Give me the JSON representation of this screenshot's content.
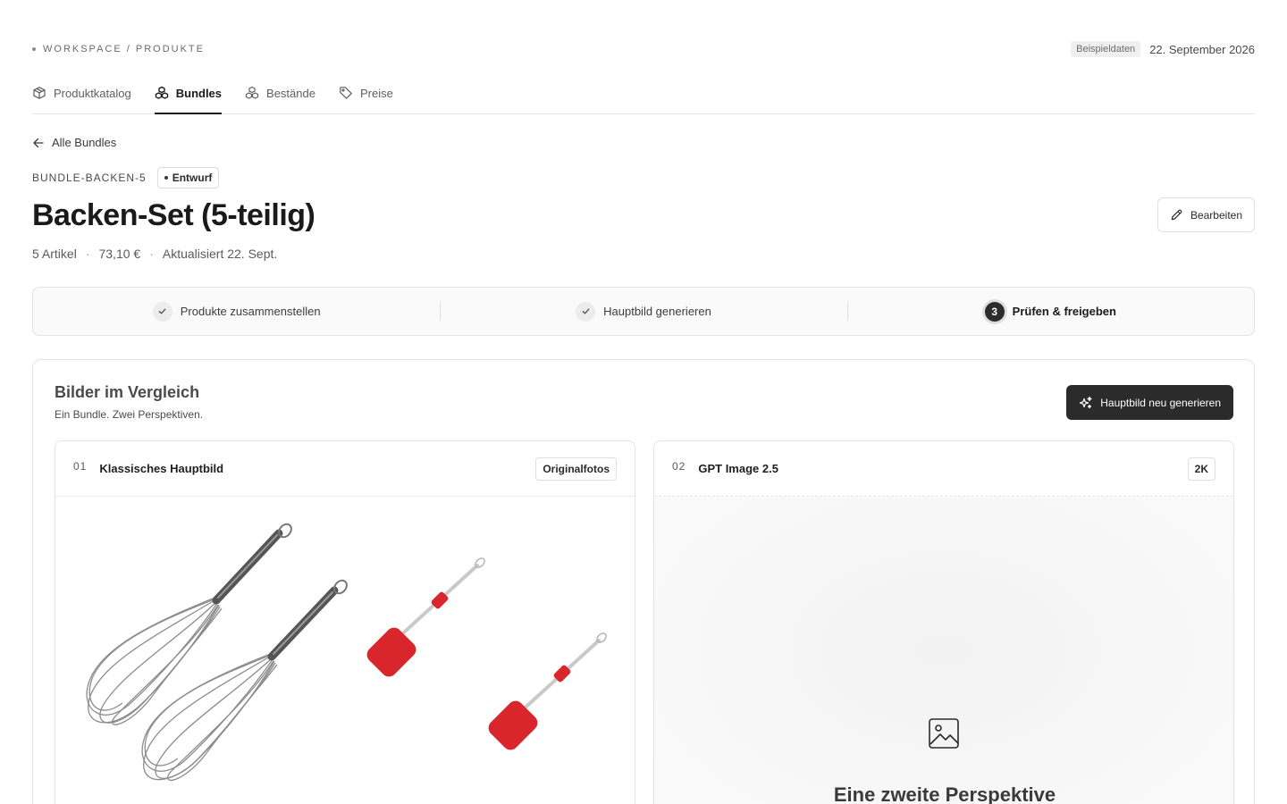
{
  "breadcrumb": {
    "text": "WORKSPACE / PRODUKTE"
  },
  "header": {
    "sample_badge": "Beispieldaten",
    "date": "22. September 2026"
  },
  "tabs": [
    {
      "label": "Produktkatalog",
      "icon": "box-icon",
      "active": false
    },
    {
      "label": "Bundles",
      "icon": "bundle-icon",
      "active": true
    },
    {
      "label": "Bestände",
      "icon": "stock-icon",
      "active": false
    },
    {
      "label": "Preise",
      "icon": "tag-icon",
      "active": false
    }
  ],
  "back_link": {
    "label": "Alle Bundles"
  },
  "bundle": {
    "sku": "BUNDLE-BACKEN-5",
    "status": "Entwurf",
    "title": "Backen-Set (5-teilig)",
    "meta": [
      "5 Artikel",
      "73,10 €",
      "Aktualisiert 22. Sept."
    ],
    "edit_label": "Bearbeiten"
  },
  "steps": [
    {
      "label": "Produkte zusammenstellen",
      "state": "done"
    },
    {
      "label": "Hauptbild generieren",
      "state": "done"
    },
    {
      "label": "Prüfen & freigeben",
      "state": "current",
      "number": "3"
    }
  ],
  "comparison": {
    "title": "Bilder im Vergleich",
    "subtitle": "Ein Bundle. Zwei Perspektiven.",
    "regen_label": "Hauptbild neu generieren",
    "panels": [
      {
        "number": "01",
        "name": "Klassisches Hauptbild",
        "tag": "Originalfotos"
      },
      {
        "number": "02",
        "name": "GPT Image 2.5",
        "tag": "2K",
        "placeholder_text": "Eine zweite Perspektive"
      }
    ]
  },
  "colors": {
    "accent": "#2b2b2b",
    "spatula_red": "#d9252c",
    "border": "#e3e3e3"
  }
}
